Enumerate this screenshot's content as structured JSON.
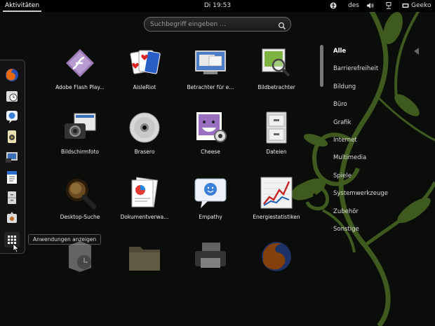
{
  "topbar": {
    "activities": "Aktivitäten",
    "clock": "Di 19:53",
    "keyboard_layout": "des",
    "user": "Geeko"
  },
  "search": {
    "placeholder": "Suchbegriff eingeben …"
  },
  "dash": {
    "items": [
      {
        "icon": "firefox-icon"
      },
      {
        "icon": "clock-icon"
      },
      {
        "icon": "empathy-icon"
      },
      {
        "icon": "speaker-icon"
      },
      {
        "icon": "screenshot-icon"
      },
      {
        "icon": "writer-icon"
      },
      {
        "icon": "files-icon"
      },
      {
        "icon": "install-icon"
      }
    ],
    "show_apps_tooltip": "Anwendungen anzeigen"
  },
  "apps": [
    {
      "label": "Adobe Flash Play...",
      "icon": "flash-icon"
    },
    {
      "label": "AisleRiot",
      "icon": "cards-icon"
    },
    {
      "label": "Betrachter für e...",
      "icon": "monitor-icon"
    },
    {
      "label": "Bildbetrachter",
      "icon": "image-viewer-icon"
    },
    {
      "label": "Bildschirmfoto",
      "icon": "camera-icon"
    },
    {
      "label": "Brasero",
      "icon": "disc-icon"
    },
    {
      "label": "Cheese",
      "icon": "cheese-icon"
    },
    {
      "label": "Dateien",
      "icon": "cabinet-icon"
    },
    {
      "label": "Desktop-Suche",
      "icon": "magnifier-icon"
    },
    {
      "label": "Dokumentverwa...",
      "icon": "documents-icon"
    },
    {
      "label": "Empathy",
      "icon": "chat-icon"
    },
    {
      "label": "Energiestatistiken",
      "icon": "graph-icon"
    },
    {
      "label": "",
      "icon": "backup-icon"
    },
    {
      "label": "",
      "icon": "folder-icon"
    },
    {
      "label": "",
      "icon": "printer-icon"
    },
    {
      "label": "",
      "icon": "firefox-icon"
    }
  ],
  "categories": [
    "Alle",
    "Barrierefreiheit",
    "Bildung",
    "Büro",
    "Grafik",
    "Internet",
    "Multimedia",
    "Spiele",
    "Systemwerkzeuge",
    "Zubehör",
    "Sonstige"
  ],
  "selected_category": "Alle",
  "colors": {
    "background": "#0b0d0a",
    "vine": "#3f5a1e",
    "text": "#eeeeee"
  }
}
